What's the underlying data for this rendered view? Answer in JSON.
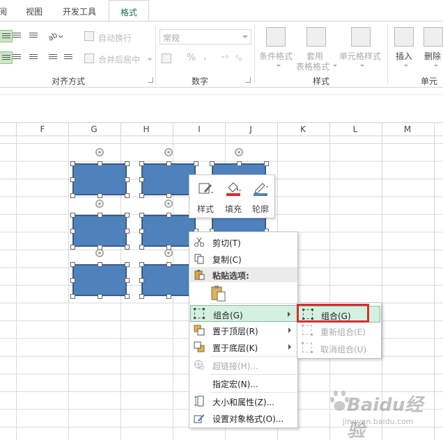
{
  "ribbon_tabs": [
    {
      "label": "阅"
    },
    {
      "label": "视图"
    },
    {
      "label": "开发工具"
    },
    {
      "label": "格式"
    }
  ],
  "alignment_group": {
    "wrap_text": "自动换行",
    "merge_center": "合并后居中",
    "label": "对齐方式"
  },
  "number_group": {
    "format_value": "常规",
    "percent_symbol": "%",
    "comma_symbol": ",",
    "label": "数字"
  },
  "styles_group": {
    "conditional_format": "条件格式",
    "table_format_line1": "套用",
    "table_format_line2": "表格格式",
    "cell_styles": "单元格样式",
    "label": "样式"
  },
  "cells_group": {
    "insert": "插入",
    "delete": "删除",
    "label": "单元格"
  },
  "columns": [
    "F",
    "G",
    "H",
    "I",
    "J",
    "K",
    "L",
    "M"
  ],
  "mini_toolbar": {
    "style": "样式",
    "fill": "填充",
    "outline": "轮廓"
  },
  "context_menu": {
    "cut": "剪切(T)",
    "copy": "复制(C)",
    "paste_options": "粘贴选项:",
    "group": "组合(G)",
    "bring_to_front": "置于顶层(R)",
    "send_to_back": "置于底层(K)",
    "hyperlink": "超链接(H)...",
    "assign_macro": "指定宏(N)...",
    "size_properties": "大小和属性(Z)...",
    "format_object": "设置对象格式(O)..."
  },
  "submenu": {
    "group": "组合(G)",
    "regroup": "重新组合(E)",
    "ungroup": "取消组合(U)"
  },
  "watermark": {
    "brand": "Baidu经验",
    "url": "jingyan.baidu.com"
  },
  "colors": {
    "shape_fill": "#4f81bd",
    "shape_border": "#385d8a",
    "highlight": "#d3f0e0",
    "annotation_red": "#e0292f",
    "active_tab": "#217346"
  }
}
